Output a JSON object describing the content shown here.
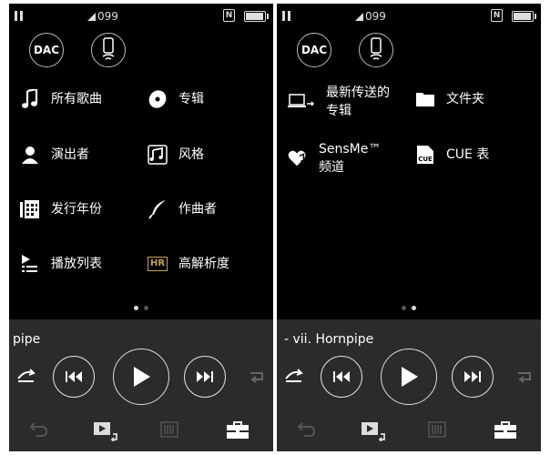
{
  "status": {
    "signal_text": "099",
    "battery_level": 0.85
  },
  "shortcuts": {
    "dac_label": "DAC"
  },
  "left_panel": {
    "menu": [
      {
        "id": "all-songs",
        "label": "所有歌曲"
      },
      {
        "id": "album",
        "label": "专辑"
      },
      {
        "id": "artist",
        "label": "演出者"
      },
      {
        "id": "genre",
        "label": "风格"
      },
      {
        "id": "release-year",
        "label": "发行年份"
      },
      {
        "id": "composer",
        "label": "作曲者"
      },
      {
        "id": "playlist",
        "label": "播放列表"
      },
      {
        "id": "hi-res",
        "label": "高解析度"
      }
    ],
    "page_indicator": {
      "current": 1,
      "total": 2
    },
    "now_playing": "pipe"
  },
  "right_panel": {
    "menu": [
      {
        "id": "recently-transferred",
        "line1": "最新传送的",
        "line2": "专辑"
      },
      {
        "id": "folder",
        "label": "文件夹"
      },
      {
        "id": "sensme",
        "line1": "SensMe™",
        "line2": "频道"
      },
      {
        "id": "cue-sheet",
        "label": "CUE 表"
      }
    ],
    "page_indicator": {
      "current": 2,
      "total": 2
    },
    "now_playing": "- vii. Hornpipe"
  },
  "icons": {
    "hr_badge": "HR",
    "cue_badge": "CUE"
  },
  "colors": {
    "background": "#000000",
    "player_bg": "#2b2b2b",
    "accent_gold": "#c8a24a",
    "text": "#ffffff"
  }
}
